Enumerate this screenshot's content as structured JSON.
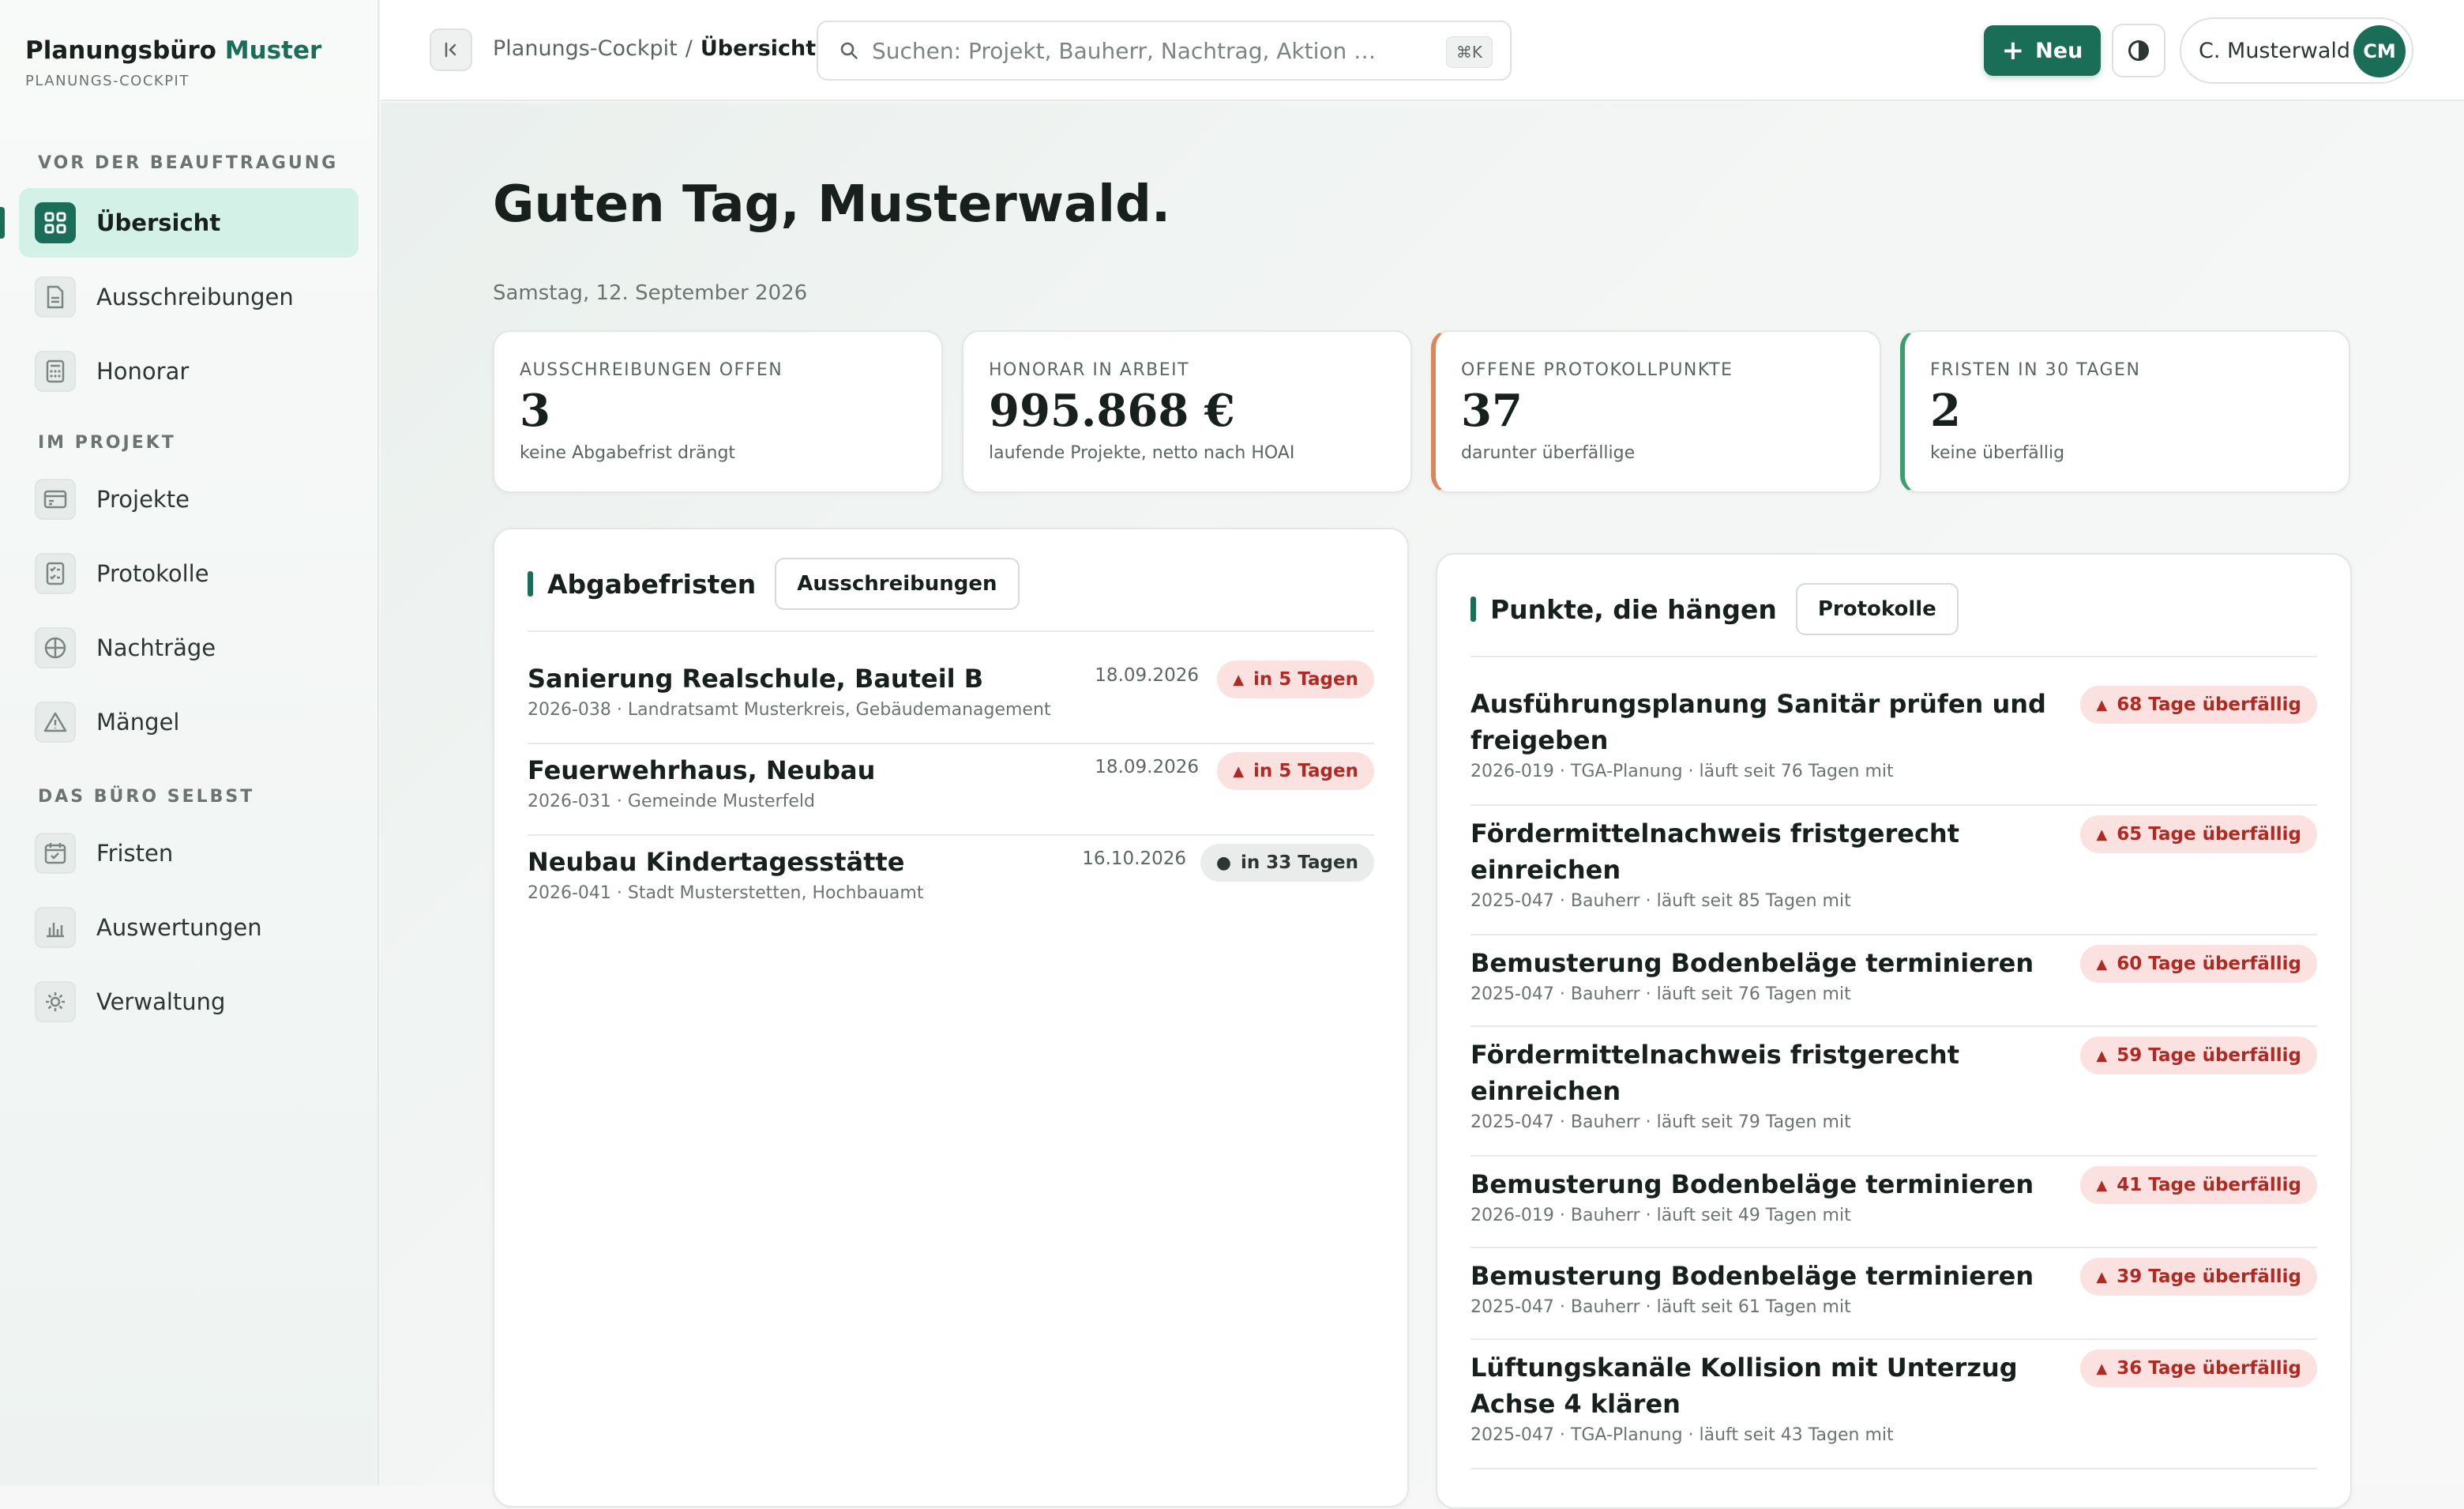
{
  "brand": {
    "name": "Planungsbüro",
    "accent": "Muster",
    "subtitle": "PLANUNGS-COCKPIT"
  },
  "sidebar": {
    "sections": [
      {
        "title": "VOR DER BEAUFTRAGUNG",
        "items": [
          {
            "label": "Übersicht",
            "icon": "grid-icon",
            "active": true
          },
          {
            "label": "Ausschreibungen",
            "icon": "document-icon"
          },
          {
            "label": "Honorar",
            "icon": "calculator-icon"
          }
        ]
      },
      {
        "title": "IM PROJEKT",
        "items": [
          {
            "label": "Projekte",
            "icon": "folder-icon"
          },
          {
            "label": "Protokolle",
            "icon": "checklist-icon"
          },
          {
            "label": "Nachträge",
            "icon": "plus-circle-icon"
          },
          {
            "label": "Mängel",
            "icon": "warning-icon"
          }
        ]
      },
      {
        "title": "DAS BÜRO SELBST",
        "items": [
          {
            "label": "Fristen",
            "icon": "calendar-icon"
          },
          {
            "label": "Auswertungen",
            "icon": "bar-chart-icon"
          },
          {
            "label": "Verwaltung",
            "icon": "gear-icon"
          }
        ]
      }
    ]
  },
  "topbar": {
    "breadcrumb": {
      "parent": "Planungs-Cockpit",
      "separator": "/",
      "current": "Übersicht"
    },
    "search": {
      "placeholder": "Suchen: Projekt, Bauherr, Nachtrag, Aktion …",
      "shortcut": "⌘K"
    },
    "new_label": "Neu",
    "user": {
      "name": "C. Musterwald",
      "initials": "CM"
    }
  },
  "main": {
    "greeting": "Guten Tag, Musterwald.",
    "date": "Samstag, 12. September 2026",
    "kpis": [
      {
        "label": "AUSSCHREIBUNGEN OFFEN",
        "value": "3",
        "sub": "keine Abgabefrist drängt",
        "accent": "none"
      },
      {
        "label": "HONORAR IN ARBEIT",
        "value": "995.868 €",
        "sub": "laufende Projekte, netto nach HOAI",
        "accent": "none"
      },
      {
        "label": "OFFENE PROTOKOLLPUNKTE",
        "value": "37",
        "sub": "darunter überfällige",
        "accent": "#d9885d"
      },
      {
        "label": "FRISTEN IN 30 TAGEN",
        "value": "2",
        "sub": "keine überfällig",
        "accent": "#3f9c6e"
      }
    ],
    "deadlines": {
      "title": "Abgabefristen",
      "link": "Ausschreibungen",
      "rows": [
        {
          "title": "Sanierung Realschule, Bauteil B",
          "meta": "2026-038 · Landratsamt Musterkreis, Gebäudemanagement",
          "date": "18.09.2026",
          "badge": "in 5 Tagen",
          "status": "urgent"
        },
        {
          "title": "Feuerwehrhaus, Neubau",
          "meta": "2026-031 · Gemeinde Musterfeld",
          "date": "18.09.2026",
          "badge": "in 5 Tagen",
          "status": "urgent"
        },
        {
          "title": "Neubau Kindertagesstätte",
          "meta": "2026-041 · Stadt Musterstetten, Hochbauamt",
          "date": "16.10.2026",
          "badge": "in 33 Tagen",
          "status": "normal"
        }
      ]
    },
    "stuck": {
      "title": "Punkte, die hängen",
      "link": "Protokolle",
      "rows": [
        {
          "title_lines": [
            "Ausführungsplanung Sanitär prüfen und",
            "freigeben"
          ],
          "meta": "2026-019 · TGA-Planung · läuft seit 76 Tagen mit",
          "badge": "68 Tage überfällig"
        },
        {
          "title_lines": [
            "Fördermittelnachweis fristgerecht",
            "einreichen"
          ],
          "meta": "2025-047 · Bauherr · läuft seit 85 Tagen mit",
          "badge": "65 Tage überfällig"
        },
        {
          "title_lines": [
            "Bemusterung Bodenbeläge terminieren"
          ],
          "meta": "2025-047 · Bauherr · läuft seit 76 Tagen mit",
          "badge": "60 Tage überfällig"
        },
        {
          "title_lines": [
            "Fördermittelnachweis fristgerecht",
            "einreichen"
          ],
          "meta": "2025-047 · Bauherr · läuft seit 79 Tagen mit",
          "badge": "59 Tage überfällig"
        },
        {
          "title_lines": [
            "Bemusterung Bodenbeläge terminieren"
          ],
          "meta": "2026-019 · Bauherr · läuft seit 49 Tagen mit",
          "badge": "41 Tage überfällig"
        },
        {
          "title_lines": [
            "Bemusterung Bodenbeläge terminieren"
          ],
          "meta": "2025-047 · Bauherr · läuft seit 61 Tagen mit",
          "badge": "39 Tage überfällig"
        },
        {
          "title_lines": [
            "Lüftungskanäle Kollision mit Unterzug",
            "Achse 4 klären"
          ],
          "meta": "2025-047 · TGA-Planung · läuft seit 43 Tagen mit",
          "badge": "36 Tage überfällig"
        }
      ]
    }
  },
  "colors": {
    "accent": "#1a6e58",
    "accent_light": "#d3f1e7",
    "danger_bg": "#fbe2e0",
    "danger_text": "#b02a24"
  }
}
